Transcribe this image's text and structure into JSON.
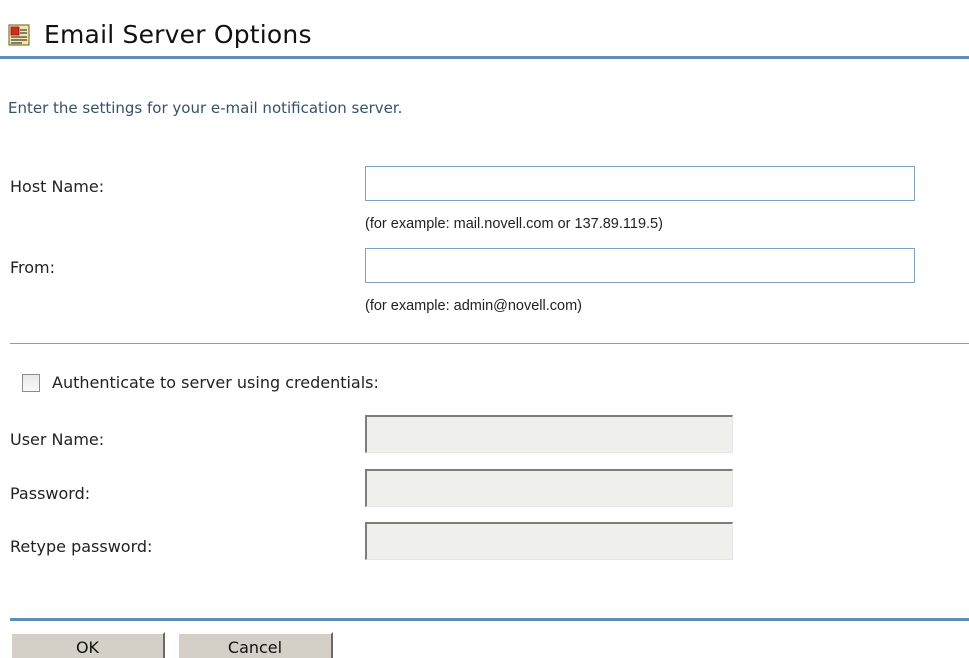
{
  "header": {
    "title": "Email Server Options",
    "icon": "email-server-icon"
  },
  "intro": "Enter the settings for your e-mail notification server.",
  "fields": {
    "host_name": {
      "label": "Host Name:",
      "value": "",
      "hint": "(for example: mail.novell.com or 137.89.119.5)"
    },
    "from": {
      "label": "From:",
      "value": "",
      "hint": "(for example: admin@novell.com)"
    }
  },
  "auth": {
    "checkbox_label": "Authenticate to server using credentials:",
    "checked": false,
    "user_name_label": "User Name:",
    "password_label": "Password:",
    "retype_label": "Retype password:"
  },
  "buttons": {
    "ok": "OK",
    "cancel": "Cancel"
  },
  "colors": {
    "accent_rule": "#5b8fb4",
    "intro_text": "#35516b",
    "button_face": "#d4d0c8",
    "disabled_field": "#efefec"
  }
}
